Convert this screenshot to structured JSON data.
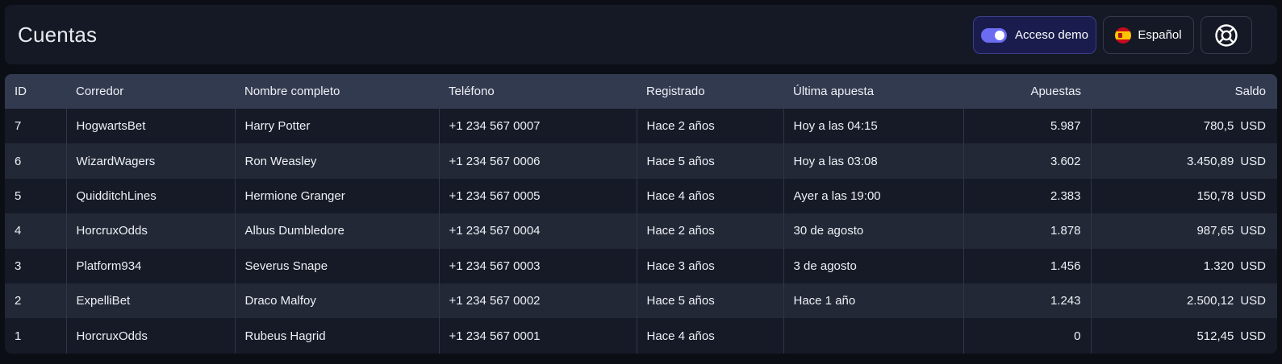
{
  "header": {
    "title": "Cuentas",
    "demo_label": "Acceso demo",
    "demo_enabled": true,
    "language_label": "Español"
  },
  "table": {
    "columns": [
      "ID",
      "Corredor",
      "Nombre completo",
      "Teléfono",
      "Registrado",
      "Última apuesta",
      "Apuestas",
      "Saldo"
    ],
    "rows": [
      {
        "id": "7",
        "broker": "HogwartsBet",
        "name": "Harry Potter",
        "phone": "+1 234 567 0007",
        "registered": "Hace 2 años",
        "last_bet": "Hoy a las 04:15",
        "bets": "5.987",
        "balance": "780,5",
        "currency": "USD"
      },
      {
        "id": "6",
        "broker": "WizardWagers",
        "name": "Ron Weasley",
        "phone": "+1 234 567 0006",
        "registered": "Hace 5 años",
        "last_bet": "Hoy a las 03:08",
        "bets": "3.602",
        "balance": "3.450,89",
        "currency": "USD"
      },
      {
        "id": "5",
        "broker": "QuidditchLines",
        "name": "Hermione Granger",
        "phone": "+1 234 567 0005",
        "registered": "Hace 4 años",
        "last_bet": "Ayer a las 19:00",
        "bets": "2.383",
        "balance": "150,78",
        "currency": "USD"
      },
      {
        "id": "4",
        "broker": "HorcruxOdds",
        "name": "Albus Dumbledore",
        "phone": "+1 234 567 0004",
        "registered": "Hace 2 años",
        "last_bet": "30 de agosto",
        "bets": "1.878",
        "balance": "987,65",
        "currency": "USD"
      },
      {
        "id": "3",
        "broker": "Platform934",
        "name": "Severus Snape",
        "phone": "+1 234 567 0003",
        "registered": "Hace 3 años",
        "last_bet": "3 de agosto",
        "bets": "1.456",
        "balance": "1.320",
        "currency": "USD"
      },
      {
        "id": "2",
        "broker": "ExpelliBet",
        "name": "Draco Malfoy",
        "phone": "+1 234 567 0002",
        "registered": "Hace 5 años",
        "last_bet": "Hace 1 año",
        "bets": "1.243",
        "balance": "2.500,12",
        "currency": "USD"
      },
      {
        "id": "1",
        "broker": "HorcruxOdds",
        "name": "Rubeus Hagrid",
        "phone": "+1 234 567 0001",
        "registered": "Hace 4 años",
        "last_bet": "",
        "bets": "0",
        "balance": "512,45",
        "currency": "USD"
      }
    ]
  }
}
